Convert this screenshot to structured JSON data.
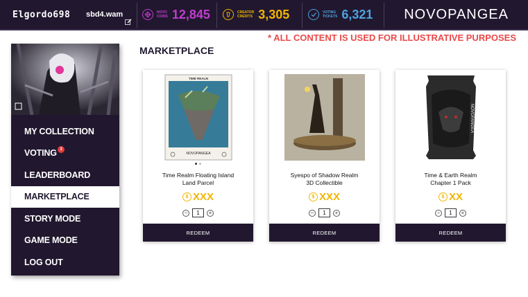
{
  "header": {
    "username": "Elgordo698",
    "wallet": "sbd4.wam",
    "currencies": [
      {
        "label_line1": "NOVO",
        "label_line2": "COINS",
        "value": "12,845",
        "color": "#c23ccf",
        "icon": "novo-coin-icon"
      },
      {
        "label_line1": "CREATOR",
        "label_line2": "CREDITS",
        "value": "3,305",
        "color": "#f2b500",
        "icon": "creator-credit-icon"
      },
      {
        "label_line1": "VOTING",
        "label_line2": "TICKETS",
        "value": "6,321",
        "color": "#4fa3e0",
        "icon": "voting-ticket-icon"
      }
    ],
    "logo": "NOVOPANGEA"
  },
  "disclaimer": "* ALL CONTENT IS USED FOR ILLUSTRATIVE PURPOSES",
  "sidebar": {
    "items": [
      {
        "label": "MY COLLECTION"
      },
      {
        "label": "VOTING",
        "badge": "3"
      },
      {
        "label": "LEADERBOARD"
      },
      {
        "label": "MARKETPLACE",
        "active": true
      },
      {
        "label": "STORY MODE"
      },
      {
        "label": "GAME MODE"
      },
      {
        "label": "LOG OUT"
      }
    ]
  },
  "main": {
    "title": "MARKETPLACE",
    "cards": [
      {
        "name_line1": "Time Realm Floating Island",
        "name_line2": "Land Parcel",
        "price": "XXX",
        "quantity": "1",
        "redeem": "REDEEM",
        "card_title": "TIME REALM",
        "card_footer": "NOVOPANGEA"
      },
      {
        "name_line1": "Syespo of Shadow Realm",
        "name_line2": "3D Collectible",
        "price": "XXX",
        "quantity": "1",
        "redeem": "REDEEM"
      },
      {
        "name_line1": "Time & Earth Realm",
        "name_line2": "Chapter 1 Pack",
        "price": "XX",
        "quantity": "1",
        "redeem": "REDEEM",
        "pack_label": "NOVOPANGEA"
      }
    ]
  }
}
